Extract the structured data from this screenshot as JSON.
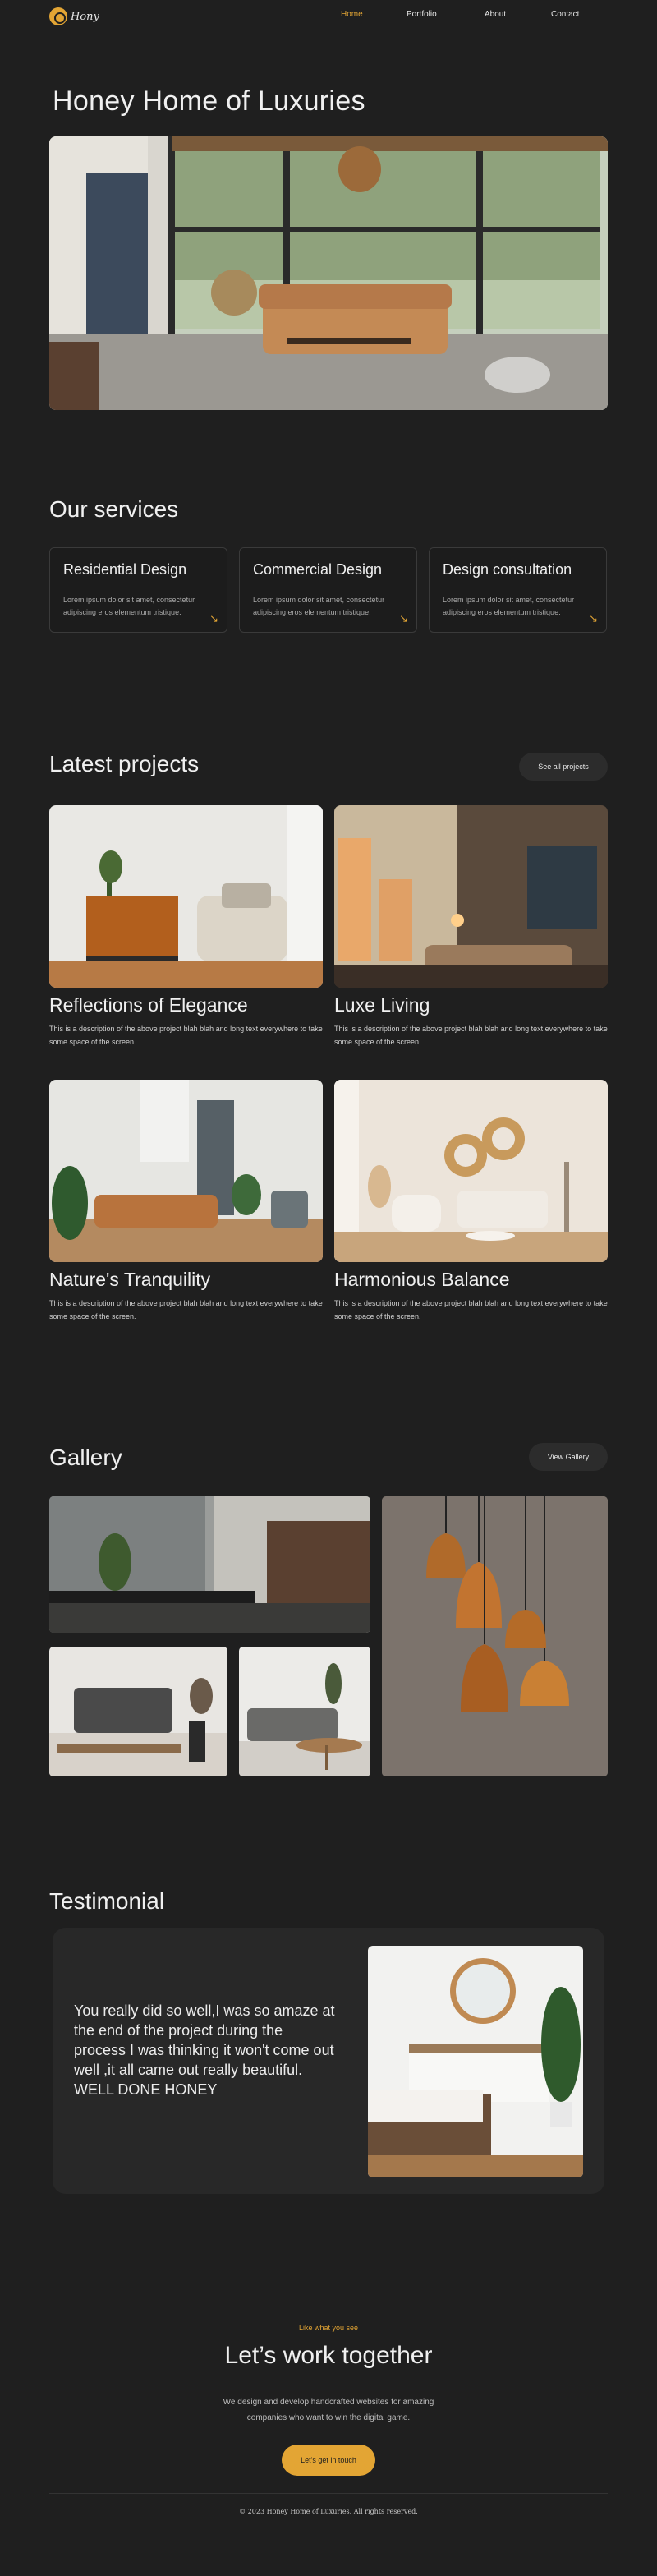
{
  "nav": {
    "logo_text": "Hony",
    "links": [
      "Home",
      "Portfolio",
      "About",
      "Contact"
    ]
  },
  "hero": {
    "title": "Honey Home of Luxuries"
  },
  "services": {
    "title": "Our services",
    "items": [
      {
        "title": "Residential Design",
        "text": "Lorem ipsum dolor sit amet, consectetur adipiscing  eros elementum tristique."
      },
      {
        "title": "Commercial Design",
        "text": "Lorem ipsum dolor sit amet, consectetur adipiscing  eros elementum tristique."
      },
      {
        "title": "Design consultation",
        "text": "Lorem ipsum dolor sit amet, consectetur adipiscing  eros elementum tristique."
      }
    ],
    "arrow_icon": "arrow-down-right-icon"
  },
  "projects": {
    "title": "Latest projects",
    "see_all": "See all projects",
    "items": [
      {
        "title": "Reflections of Elegance",
        "desc": "This is a description of the above project blah blah and long text everywhere to take some space of the screen."
      },
      {
        "title": "Luxe Living",
        "desc": "This is a description of the above project blah blah and long text everywhere to take some space of the screen."
      },
      {
        "title": "Nature's Tranquility",
        "desc": "This is a description of the above project blah blah and long text everywhere to take some space of the screen."
      },
      {
        "title": "Harmonious Balance",
        "desc": "This is a description of the above project blah blah and long text everywhere to take some space of the screen."
      }
    ]
  },
  "gallery": {
    "title": "Gallery",
    "view": "View Gallery"
  },
  "testimonial": {
    "title": "Testimonial",
    "quote": "You really did so well,I was so amaze at the end of the project during the process I was thinking it won't come out well ,it all came out really beautiful.",
    "signoff": "WELL DONE HONEY"
  },
  "cta": {
    "kicker": "Like what you see",
    "title": "Let’s work together",
    "sub": "We design and develop handcrafted websites for amazing companies who want to win the digital game.",
    "button": "Let's get in touch"
  },
  "footer": {
    "copyright": "© 2023 Honey Home of Luxuries. All rights reserved."
  },
  "colors": {
    "background": "#1f1f1f",
    "accent": "#e3a534",
    "card": "#282828"
  }
}
